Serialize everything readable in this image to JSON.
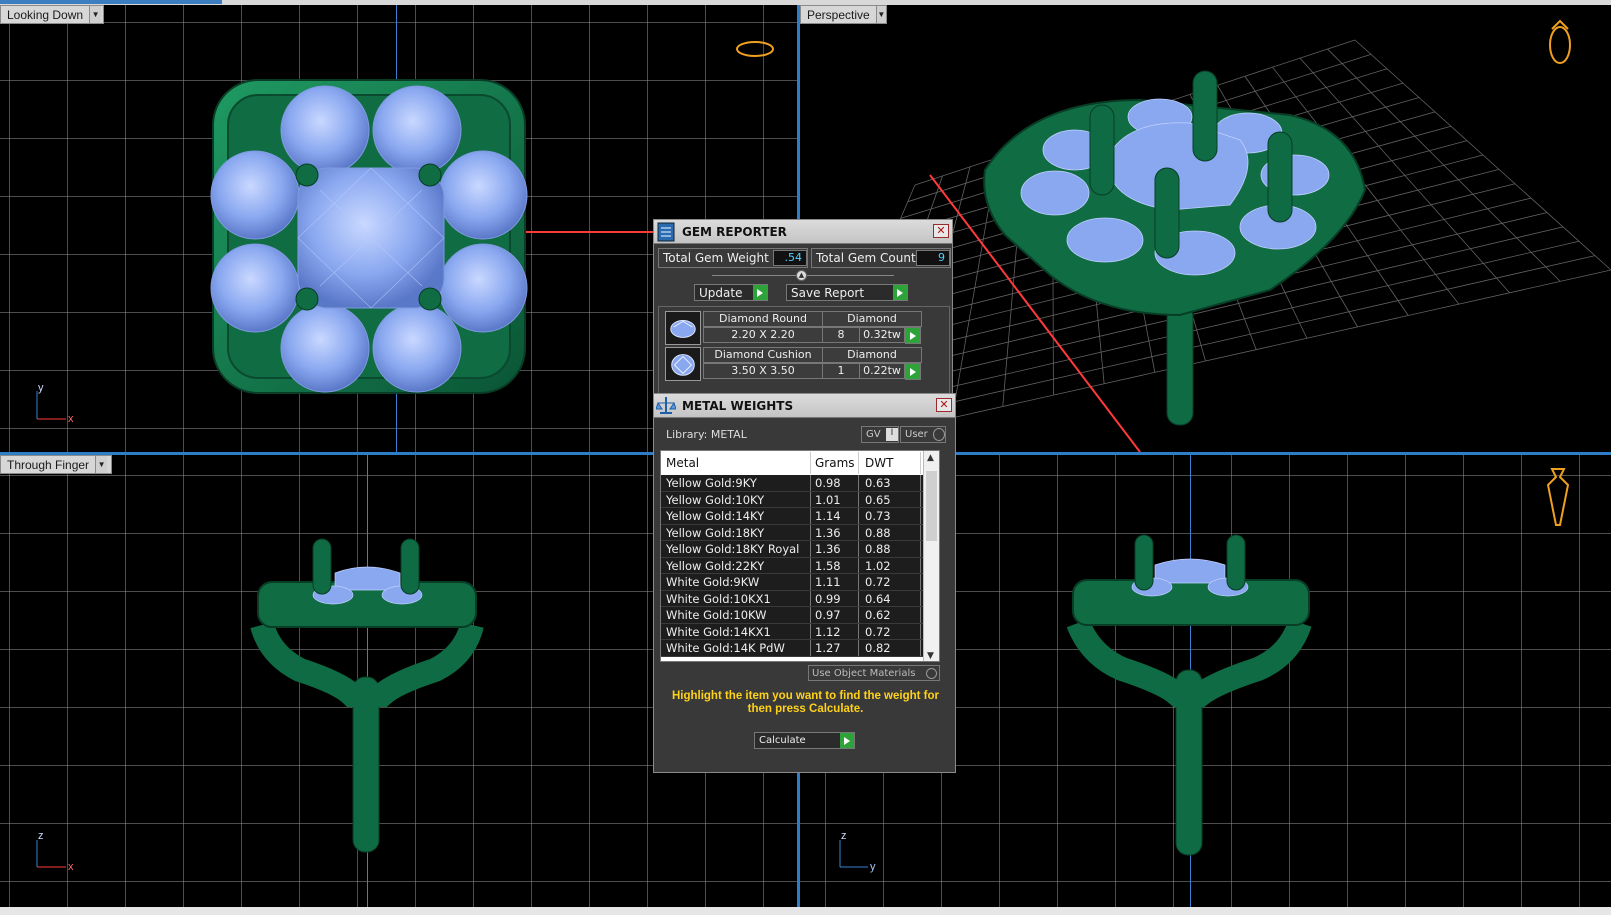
{
  "viewports": {
    "top_left": {
      "label": "Looking Down",
      "axes": [
        "y",
        "x"
      ]
    },
    "top_right": {
      "label": "Perspective"
    },
    "bottom_left": {
      "label": "Through Finger",
      "axes": [
        "z",
        "x"
      ]
    },
    "bottom_right": {
      "axes": [
        "z",
        "y"
      ]
    }
  },
  "gem_reporter": {
    "title": "GEM REPORTER",
    "total_weight_label": "Total Gem Weight",
    "total_weight_value": ".54",
    "total_count_label": "Total Gem Count",
    "total_count_value": "9",
    "update_label": "Update",
    "save_label": "Save Report",
    "gems": [
      {
        "name": "Diamond Round",
        "material": "Diamond",
        "size": "2.20 X 2.20",
        "count": "8",
        "weight": "0.32tw"
      },
      {
        "name": "Diamond Cushion",
        "material": "Diamond",
        "size": "3.50 X 3.50",
        "count": "1",
        "weight": "0.22tw"
      }
    ]
  },
  "metal_weights": {
    "title": "METAL WEIGHTS",
    "library_label": "Library: METAL",
    "gv_label": "GV",
    "user_label": "User",
    "columns": [
      "Metal",
      "Grams",
      "DWT"
    ],
    "rows": [
      [
        "Yellow Gold:9KY",
        "0.98",
        "0.63"
      ],
      [
        "Yellow Gold:10KY",
        "1.01",
        "0.65"
      ],
      [
        "Yellow Gold:14KY",
        "1.14",
        "0.73"
      ],
      [
        "Yellow Gold:18KY",
        "1.36",
        "0.88"
      ],
      [
        "Yellow Gold:18KY Royal",
        "1.36",
        "0.88"
      ],
      [
        "Yellow Gold:22KY",
        "1.58",
        "1.02"
      ],
      [
        "White Gold:9KW",
        "1.11",
        "0.72"
      ],
      [
        "White Gold:10KX1",
        "0.99",
        "0.64"
      ],
      [
        "White Gold:10KW",
        "0.97",
        "0.62"
      ],
      [
        "White Gold:14KX1",
        "1.12",
        "0.72"
      ],
      [
        "White Gold:14K PdW",
        "1.27",
        "0.82"
      ]
    ],
    "use_object_materials": "Use Object Materials",
    "hint": "Highlight the item you want to find the weight for then press Calculate.",
    "calculate_label": "Calculate"
  },
  "colors": {
    "metal_green": "#0e6b43",
    "gem_blue": "#8aa8f0",
    "grid": "#8c8c8c",
    "axis_red": "#ff3a3a",
    "separator_blue": "#2e7dc7",
    "hint_yellow": "#ffd21a"
  }
}
